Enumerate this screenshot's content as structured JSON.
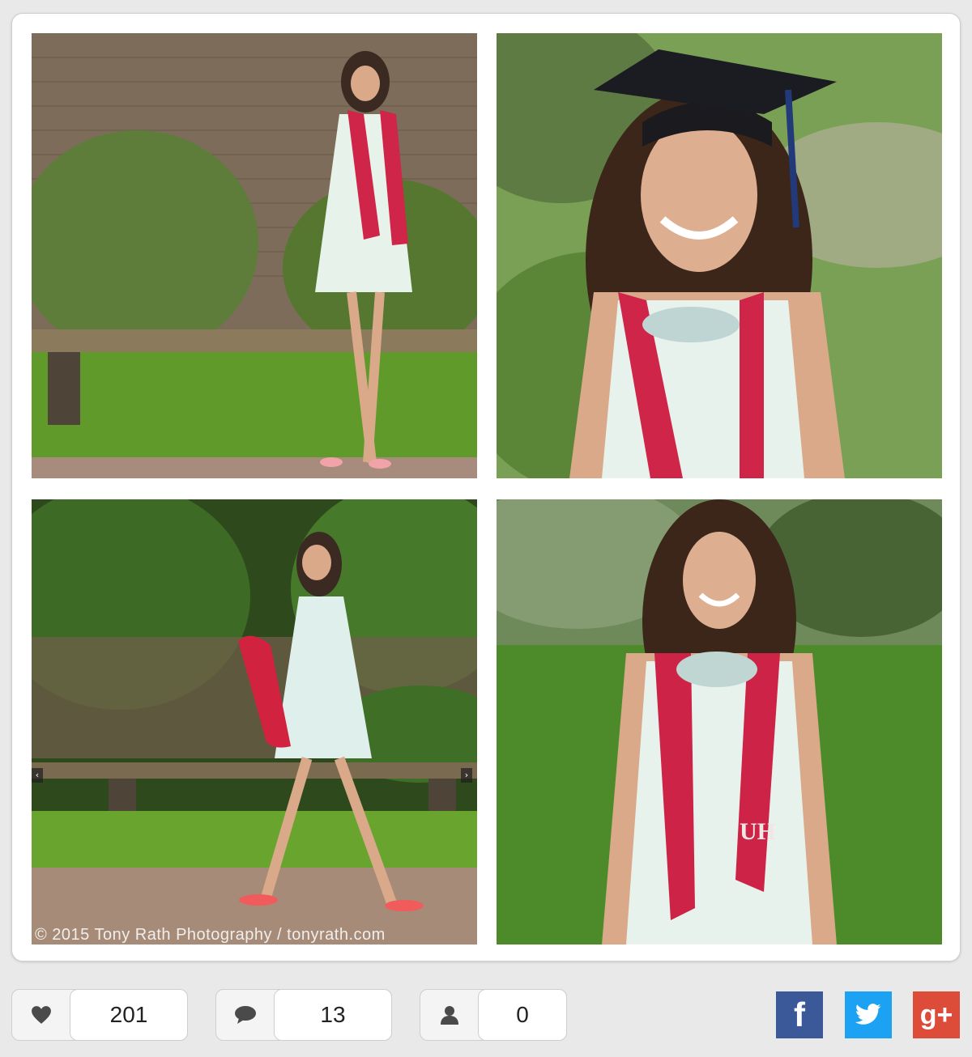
{
  "gallery": {
    "photos": [
      {
        "description_icon": "photo-standing-pose"
      },
      {
        "description_icon": "photo-cap-closeup"
      },
      {
        "description_icon": "photo-walking"
      },
      {
        "description_icon": "photo-stole-portrait"
      }
    ],
    "watermark": "© 2015 Tony Rath Photography / tonyrath.com",
    "prev_arrow": "‹",
    "next_arrow": "›"
  },
  "stats": {
    "likes": {
      "icon": "heart-icon",
      "value": "201"
    },
    "comments": {
      "icon": "comment-icon",
      "value": "13"
    },
    "followers": {
      "icon": "person-icon",
      "value": "0"
    }
  },
  "share": {
    "facebook": {
      "label": "f",
      "color": "#3b5998"
    },
    "twitter": {
      "icon": "twitter-bird-icon",
      "color": "#1da1f2"
    },
    "googleplus": {
      "label": "g+",
      "color": "#dd4b39"
    }
  }
}
